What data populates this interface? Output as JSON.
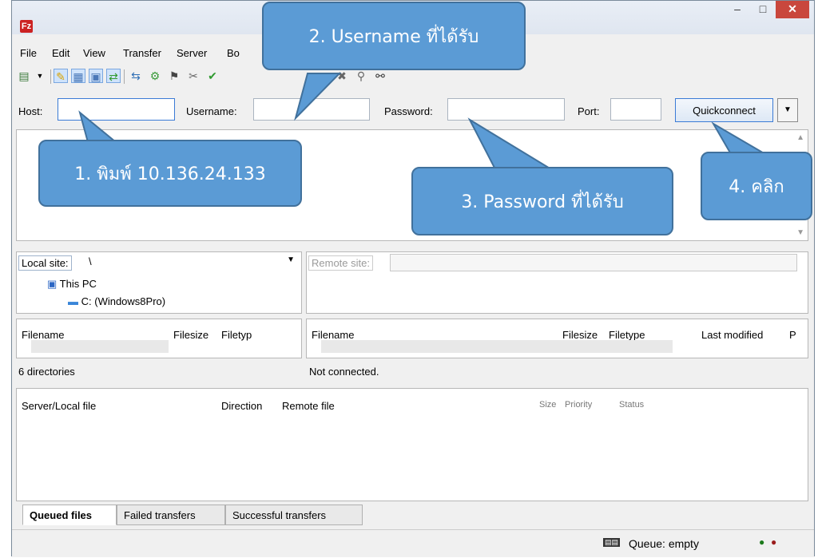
{
  "window": {
    "app_icon": "Fz",
    "app_icon_name": "filezilla-icon",
    "minimize": "‒",
    "maximize": "□",
    "close": "✕"
  },
  "menu": [
    "File",
    "Edit",
    "View",
    "Transfer",
    "Server",
    "Bo"
  ],
  "quickconnect": {
    "host_label": "Host:",
    "host_value": "",
    "username_label": "Username:",
    "username_value": "",
    "password_label": "Password:",
    "password_value": "",
    "port_label": "Port:",
    "port_value": "",
    "button": "Quickconnect",
    "dropdown": "▼"
  },
  "local": {
    "site_label": "Local site:",
    "site_value": "\\",
    "tree": [
      {
        "label": "This PC",
        "icon": "computer-icon"
      },
      {
        "label": "C: (Windows8Pro)",
        "icon": "drive-icon"
      }
    ],
    "columns": [
      "Filename",
      "Filesize",
      "Filetyp"
    ],
    "status": "6 directories"
  },
  "remote": {
    "site_label": "Remote site:",
    "site_value": "",
    "columns": [
      "Filename",
      "Filesize",
      "Filetype",
      "Last modified",
      "P"
    ],
    "status": "Not connected."
  },
  "queue": {
    "columns": [
      "Server/Local file",
      "Direction",
      "Remote file",
      "Size",
      "Priority",
      "Status"
    ],
    "tabs": [
      "Queued files",
      "Failed transfers",
      "Successful transfers"
    ],
    "active_tab": "Queued files",
    "status": "Queue: empty"
  },
  "callouts": {
    "step1": "1. พิมพ์ 10.136.24.133",
    "step2": "2. Username ที่ได้รับ",
    "step3": "3. Password ที่ได้รับ",
    "step4": "4. คลิก",
    "color": "#5b9bd5",
    "border_color": "#41719c"
  }
}
